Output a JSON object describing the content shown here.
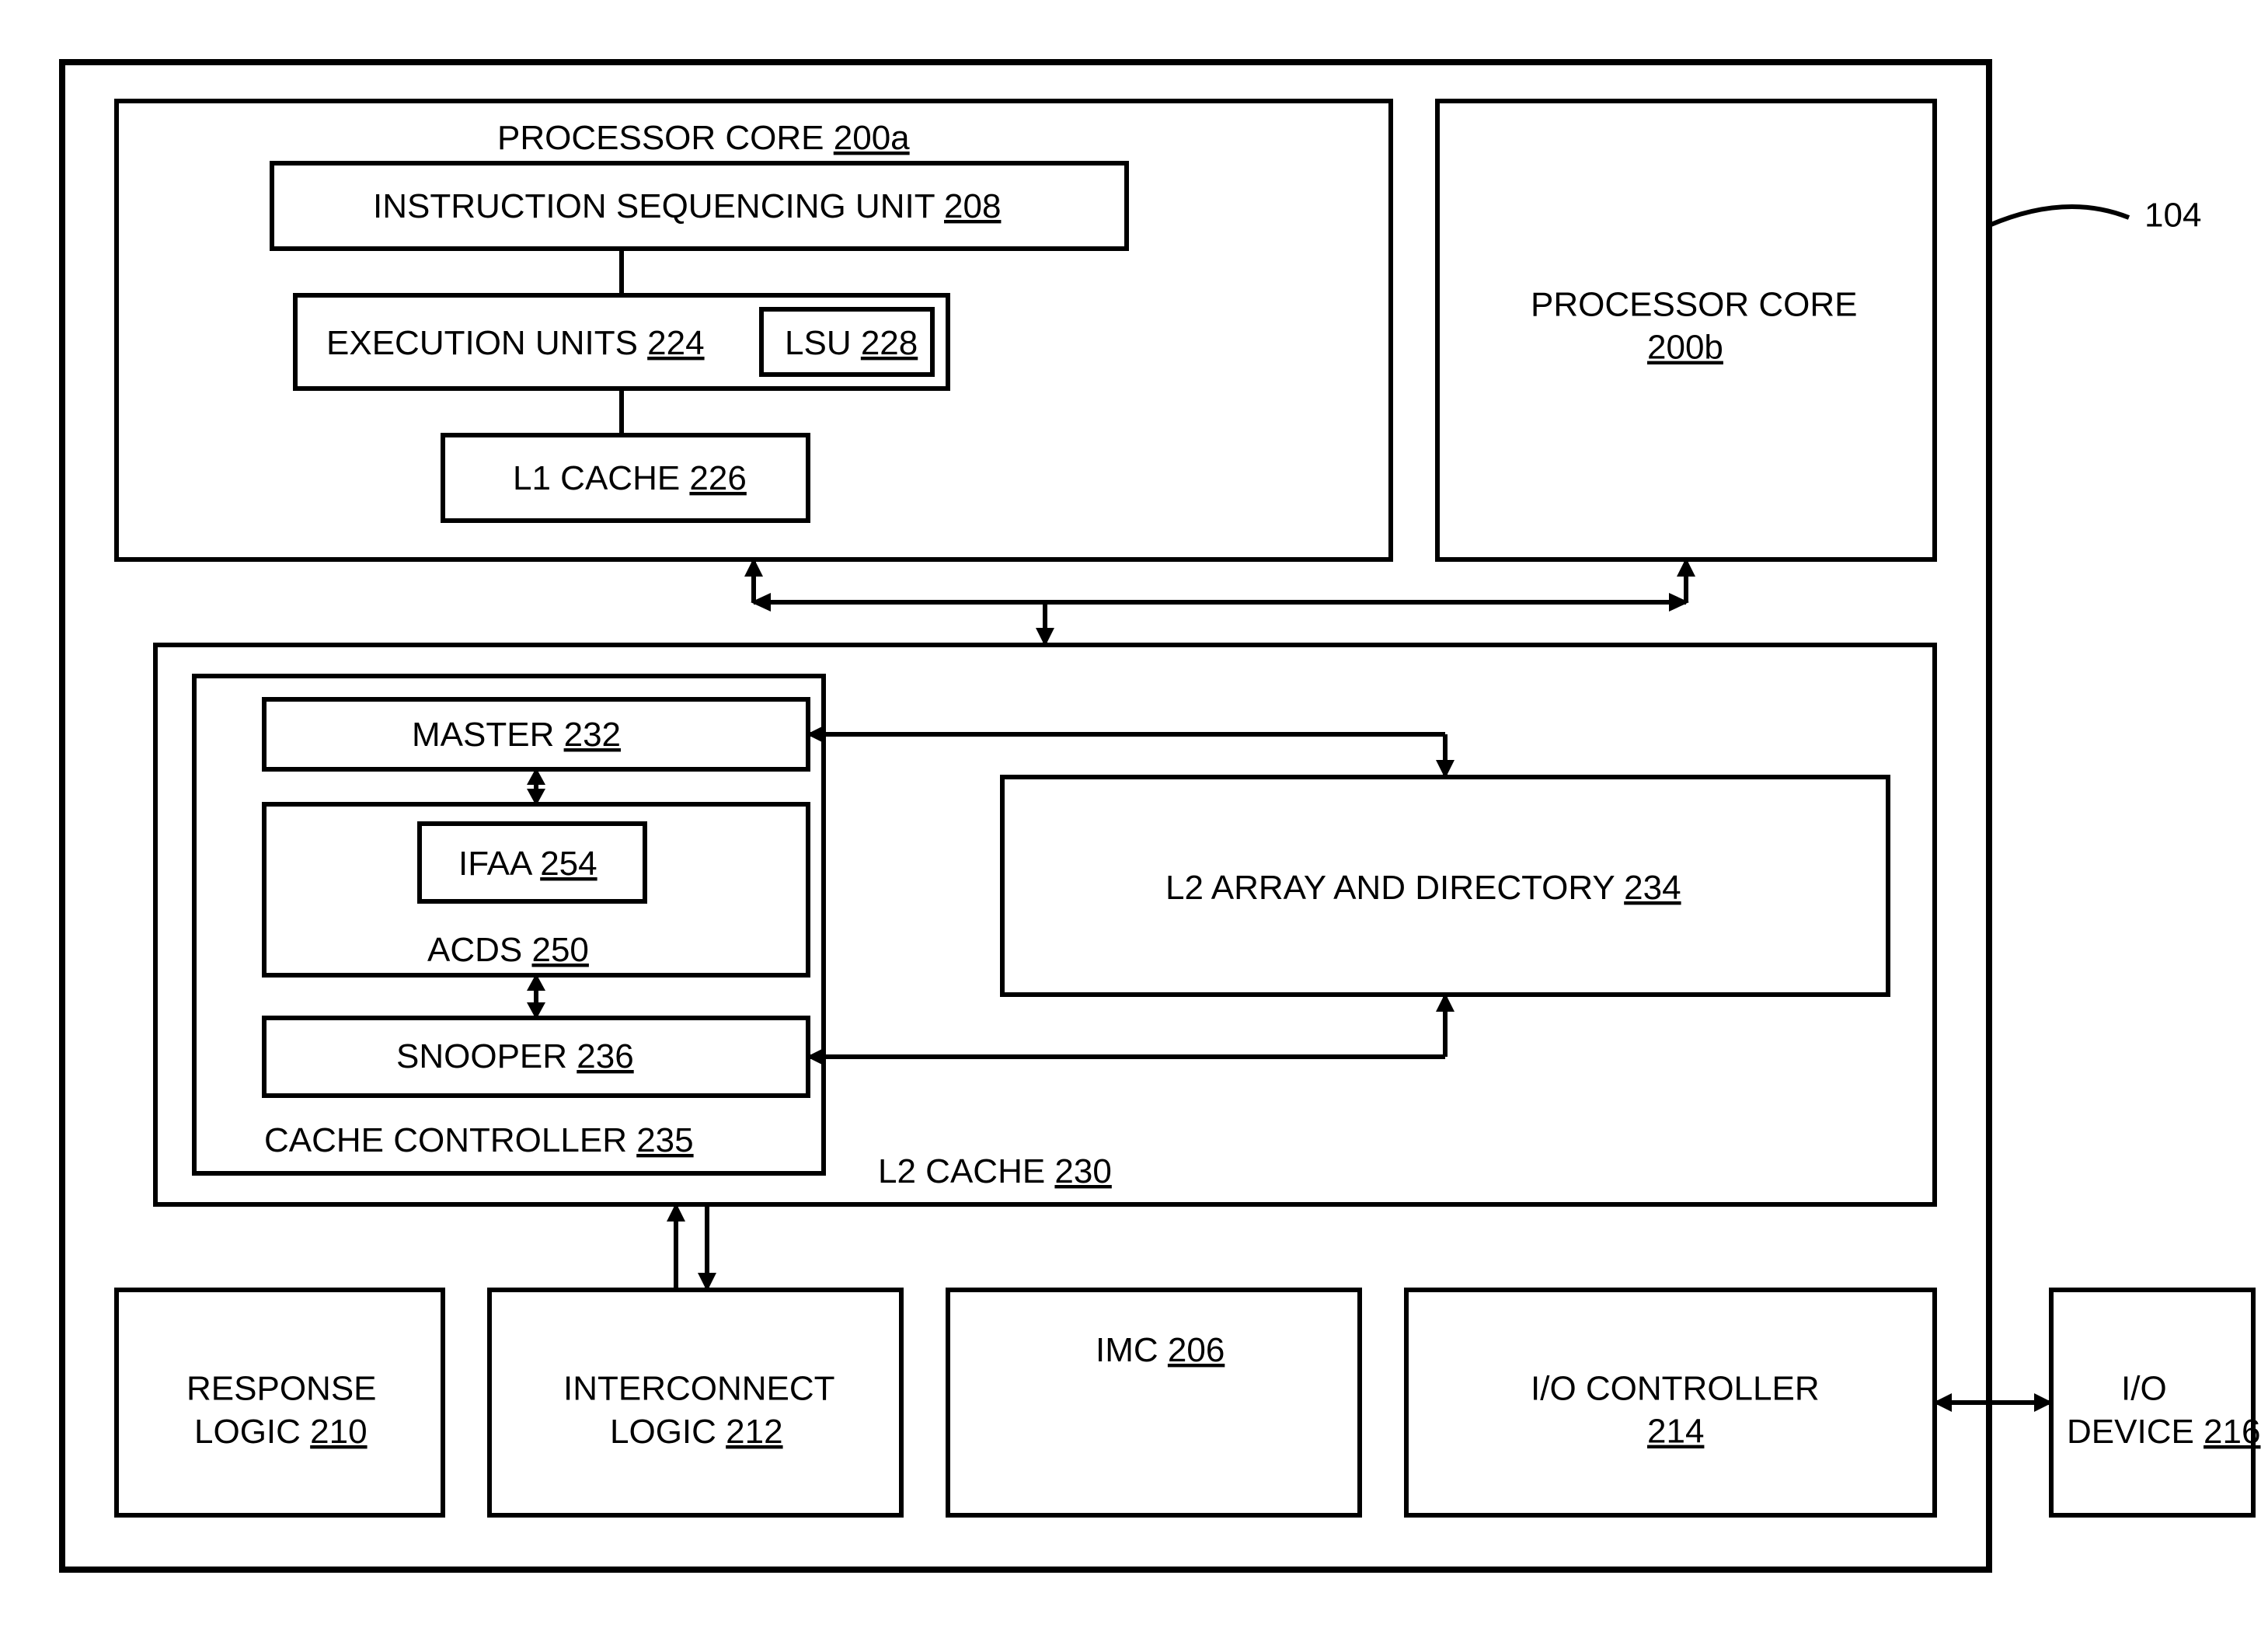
{
  "figure_ref": "104",
  "chip": {
    "core_a": {
      "title": "PROCESSOR CORE",
      "ref": "200a",
      "isu": {
        "label": "INSTRUCTION SEQUENCING UNIT",
        "ref": "208"
      },
      "exu": {
        "label": "EXECUTION UNITS",
        "ref": "224"
      },
      "lsu": {
        "label": "LSU",
        "ref": "228"
      },
      "l1": {
        "label": "L1 CACHE",
        "ref": "226"
      }
    },
    "core_b": {
      "title": "PROCESSOR CORE",
      "ref": "200b"
    },
    "l2": {
      "label": "L2 CACHE",
      "ref": "230",
      "controller": {
        "label": "CACHE CONTROLLER",
        "ref": "235",
        "master": {
          "label": "MASTER",
          "ref": "232"
        },
        "acds": {
          "label": "ACDS",
          "ref": "250"
        },
        "ifaa": {
          "label": "IFAA",
          "ref": "254"
        },
        "snooper": {
          "label": "SNOOPER",
          "ref": "236"
        }
      },
      "array": {
        "label": "L2 ARRAY AND DIRECTORY",
        "ref": "234"
      }
    },
    "response": {
      "label": "RESPONSE LOGIC",
      "ref": "210"
    },
    "interconnect": {
      "label": "INTERCONNECT LOGIC",
      "ref": "212"
    },
    "imc": {
      "label": "IMC",
      "ref": "206"
    },
    "ioctl": {
      "label": "I/O CONTROLLER",
      "ref": "214"
    }
  },
  "iodev": {
    "label": "I/O DEVICE",
    "ref": "216"
  }
}
